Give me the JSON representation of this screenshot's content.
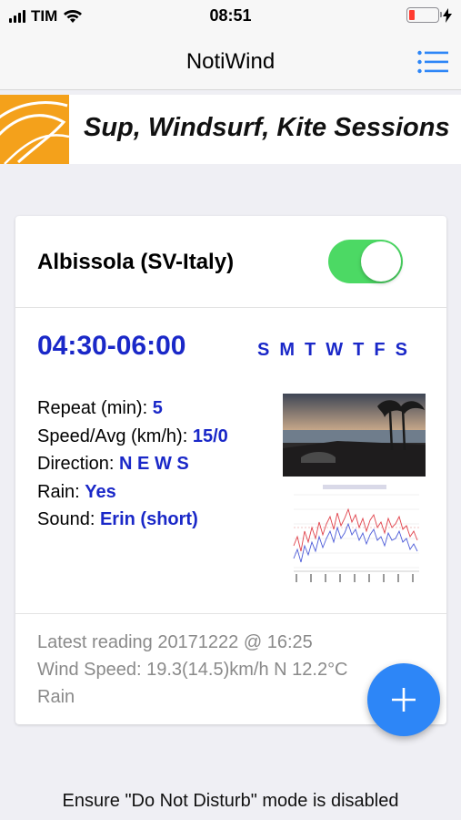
{
  "status_bar": {
    "carrier": "TIM",
    "time": "08:51",
    "battery_level": 0.2,
    "icons": [
      "signal-icon",
      "wifi-icon",
      "battery-icon",
      "charging-bolt-icon"
    ]
  },
  "nav": {
    "title": "NotiWind",
    "menu_icon": "hamburger-menu-icon"
  },
  "banner": {
    "text": "Sup, Windsurf, Kite Sessions",
    "logo": "wave-logo"
  },
  "alert": {
    "location": "Albissola (SV-Italy)",
    "enabled": true,
    "time_range": "04:30-06:00",
    "days": [
      "S",
      "M",
      "T",
      "W",
      "T",
      "F",
      "S"
    ],
    "repeat_label": "Repeat (min):",
    "repeat_value": "5",
    "speed_label": "Speed/Avg (km/h):",
    "speed_value": "15/0",
    "direction_label": "Direction:",
    "direction_value": "N E W S",
    "rain_label": "Rain:",
    "rain_value": "Yes",
    "sound_label": "Sound:",
    "sound_value": "Erin (short)",
    "latest_reading": "Latest reading 20171222 @ 16:25",
    "wind_speed": "Wind Speed: 19.3(14.5)km/h N 12.2°C",
    "weather": "Rain"
  },
  "fab_icon": "plus-icon",
  "bottom_note": "Ensure \"Do Not Disturb\" mode is disabled",
  "colors": {
    "accent": "#1a28c8",
    "toggle_on": "#4cd964",
    "fab": "#2d86f7",
    "menu": "#2d86f7",
    "battery_low": "#ff3b30"
  }
}
